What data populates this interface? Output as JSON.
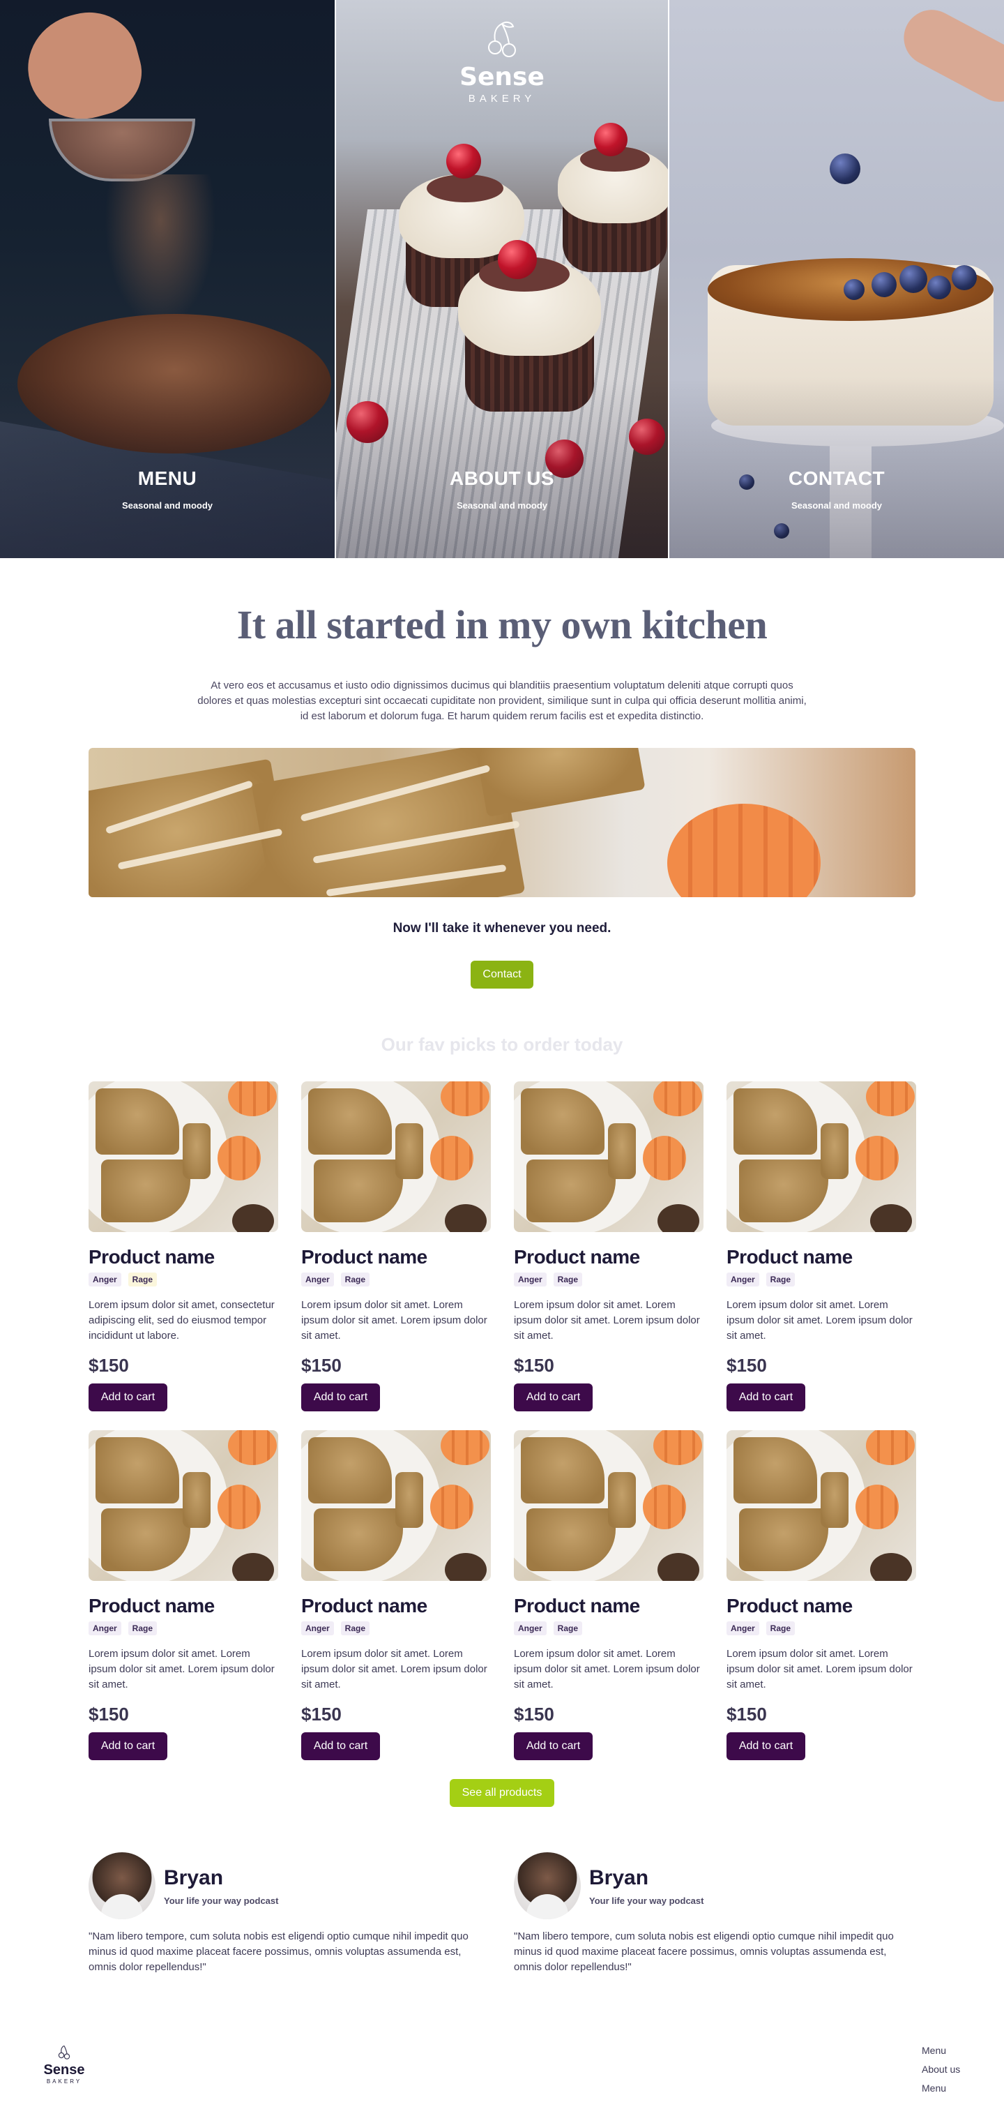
{
  "hero": {
    "logo": {
      "name": "Sense",
      "tagline": "BAKERY"
    },
    "panels": [
      {
        "title": "MENU",
        "subtitle": "Seasonal and moody"
      },
      {
        "title": "ABOUT US",
        "subtitle": "Seasonal and moody"
      },
      {
        "title": "CONTACT",
        "subtitle": "Seasonal and moody"
      }
    ]
  },
  "intro": {
    "title": "It all started in my own kitchen",
    "text": "At vero eos et accusamus et iusto odio dignissimos ducimus qui blanditiis praesentium voluptatum deleniti atque corrupti quos dolores et quas molestias excepturi sint occaecati cupiditate non provident, similique sunt in culpa qui officia deserunt mollitia animi, id est laborum et dolorum fuga. Et harum quidem rerum facilis est et expedita distinctio.",
    "cta_text": "Now I'll take it whenever you need.",
    "contact_label": "Contact"
  },
  "picks": {
    "title": "Our fav picks to order today",
    "products": [
      {
        "name": "Product name",
        "tags": [
          "Anger",
          "Rage"
        ],
        "desc": "Lorem ipsum dolor sit amet, consectetur adipiscing elit, sed do eiusmod tempor incididunt ut labore.",
        "price": "$150",
        "cart": "Add to cart"
      },
      {
        "name": "Product name",
        "tags": [
          "Anger",
          "Rage"
        ],
        "desc": "Lorem ipsum dolor sit amet. Lorem ipsum dolor sit amet. Lorem ipsum dolor sit amet.",
        "price": "$150",
        "cart": "Add to cart"
      },
      {
        "name": "Product name",
        "tags": [
          "Anger",
          "Rage"
        ],
        "desc": "Lorem ipsum dolor sit amet. Lorem ipsum dolor sit amet. Lorem ipsum dolor sit amet.",
        "price": "$150",
        "cart": "Add to cart"
      },
      {
        "name": "Product name",
        "tags": [
          "Anger",
          "Rage"
        ],
        "desc": "Lorem ipsum dolor sit amet. Lorem ipsum dolor sit amet. Lorem ipsum dolor sit amet.",
        "price": "$150",
        "cart": "Add to cart"
      },
      {
        "name": "Product name",
        "tags": [
          "Anger",
          "Rage"
        ],
        "desc": "Lorem ipsum dolor sit amet. Lorem ipsum dolor sit amet. Lorem ipsum dolor sit amet.",
        "price": "$150",
        "cart": "Add to cart"
      },
      {
        "name": "Product name",
        "tags": [
          "Anger",
          "Rage"
        ],
        "desc": "Lorem ipsum dolor sit amet. Lorem ipsum dolor sit amet. Lorem ipsum dolor sit amet.",
        "price": "$150",
        "cart": "Add to cart"
      },
      {
        "name": "Product name",
        "tags": [
          "Anger",
          "Rage"
        ],
        "desc": "Lorem ipsum dolor sit amet. Lorem ipsum dolor sit amet. Lorem ipsum dolor sit amet.",
        "price": "$150",
        "cart": "Add to cart"
      },
      {
        "name": "Product name",
        "tags": [
          "Anger",
          "Rage"
        ],
        "desc": "Lorem ipsum dolor sit amet. Lorem ipsum dolor sit amet. Lorem ipsum dolor sit amet.",
        "price": "$150",
        "cart": "Add to cart"
      }
    ],
    "see_all_label": "See all products"
  },
  "testimonials": [
    {
      "name": "Bryan",
      "role": "Your life your way podcast",
      "quote": "\"Nam libero tempore, cum soluta nobis est eligendi optio cumque nihil impedit quo minus id quod maxime placeat facere possimus, omnis voluptas assumenda est, omnis dolor repellendus!\""
    },
    {
      "name": "Bryan",
      "role": "Your life your way podcast",
      "quote": "\"Nam libero tempore, cum soluta nobis est eligendi optio cumque nihil impedit quo minus id quod maxime placeat facere possimus, omnis voluptas assumenda est, omnis dolor repellendus!\""
    }
  ],
  "footer": {
    "logo": {
      "name": "Sense",
      "tagline": "BAKERY"
    },
    "nav": [
      "Menu",
      "About us",
      "Menu"
    ]
  },
  "colors": {
    "brand_purple": "#3d0a4a",
    "accent_green": "#8bb313",
    "accent_lime": "#a4cf14",
    "title_slate": "#5a5e76"
  }
}
